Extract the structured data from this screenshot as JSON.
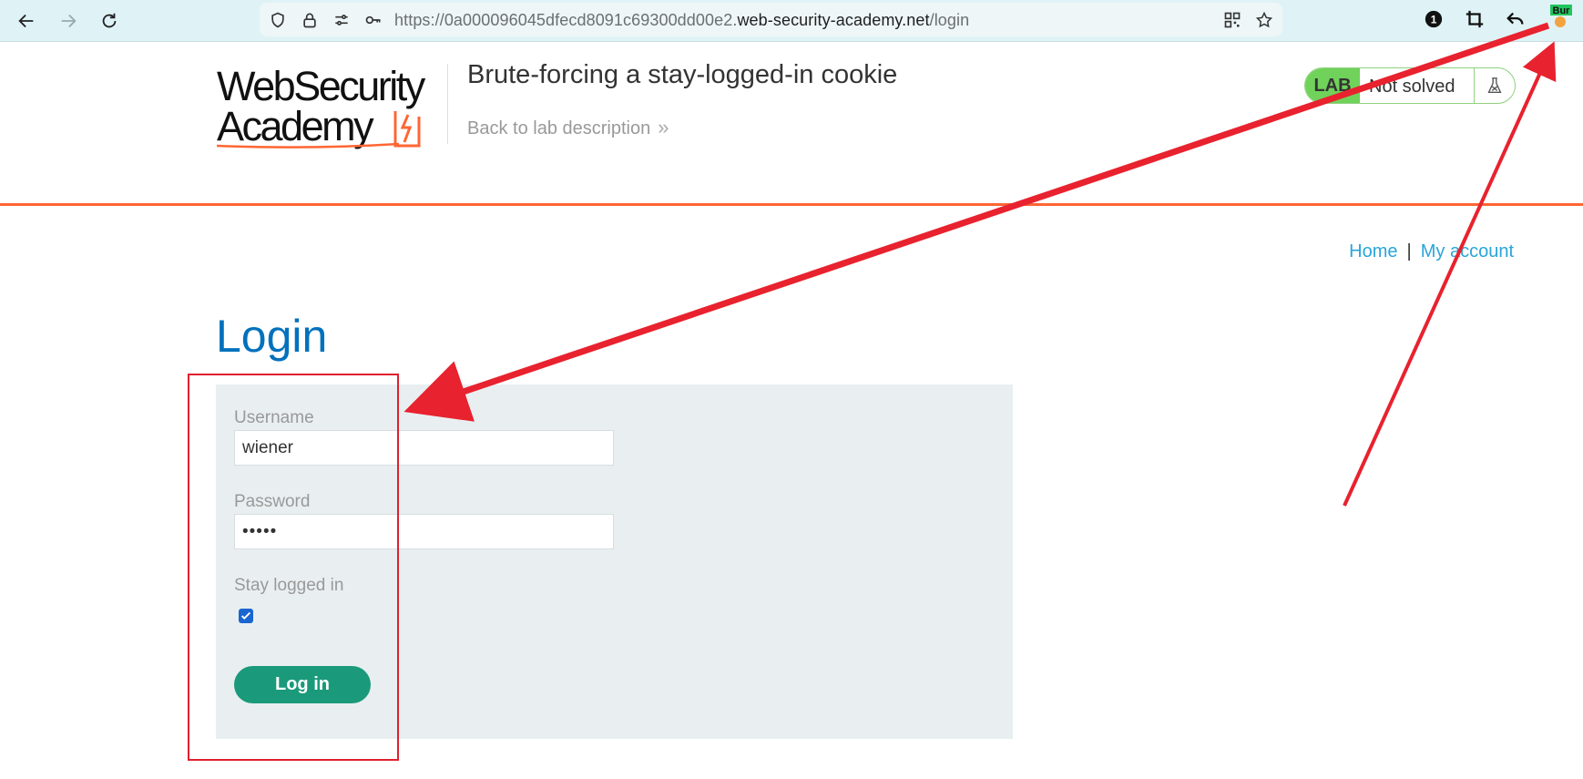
{
  "browser": {
    "url_prefix": "https://0a000096045dfecd8091c69300dd00e2.",
    "url_domain": "web-security-academy.net",
    "url_path": "/login",
    "badge_count": "1",
    "extension_label": "Bur",
    "icons": [
      "back-arrow-icon",
      "forward-arrow-icon",
      "reload-icon",
      "shield-icon",
      "lock-icon",
      "permissions-icon",
      "key-icon",
      "qr-code-icon",
      "star-icon",
      "counter-badge-icon",
      "crop-icon",
      "undo-icon",
      "burp-extension-icon"
    ]
  },
  "header": {
    "logo_line1": "WebSecurity",
    "logo_line2": "Academy",
    "lab_title": "Brute-forcing a stay-logged-in cookie",
    "back_link": "Back to lab description",
    "lab_badge": "LAB",
    "lab_status": "Not solved"
  },
  "nav": {
    "home": "Home",
    "separator": "|",
    "my_account": "My account"
  },
  "main": {
    "title": "Login",
    "username_label": "Username",
    "username_value": "wiener",
    "password_label": "Password",
    "password_value": "•••••",
    "stay_logged_in_label": "Stay logged in",
    "stay_logged_in_checked": true,
    "login_button": "Log in"
  },
  "colors": {
    "accent_blue": "#0071bc",
    "link_blue": "#29a5d8",
    "orange": "#ff6633",
    "lab_green": "#70d25a",
    "button_green": "#1a9a7a",
    "annotation_red": "#e02030"
  }
}
